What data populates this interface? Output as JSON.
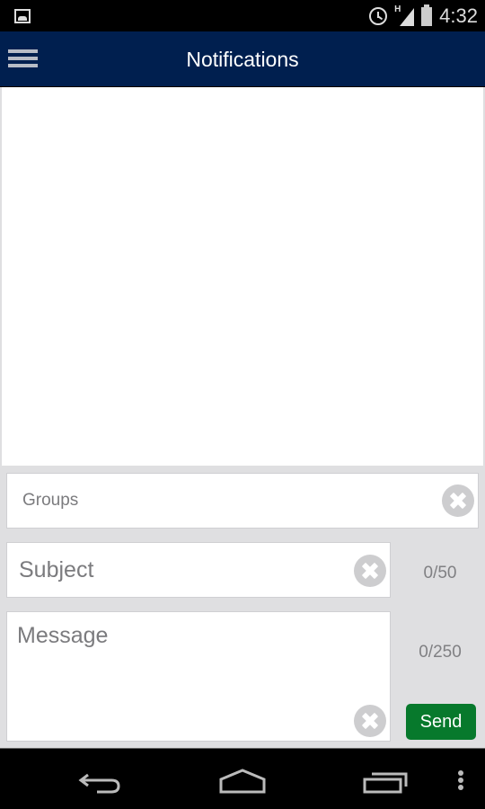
{
  "status_bar": {
    "time": "4:32",
    "network_type": "H",
    "icons": [
      "image-notification-icon",
      "alarm-icon",
      "signal-icon",
      "battery-icon"
    ]
  },
  "app_bar": {
    "title": "Notifications",
    "menu_icon": "hamburger-menu-icon"
  },
  "notifications": {
    "items": []
  },
  "form": {
    "groups": {
      "placeholder": "Groups",
      "value": ""
    },
    "subject": {
      "placeholder": "Subject",
      "value": "",
      "counter": "0/50"
    },
    "message": {
      "placeholder": "Message",
      "value": "",
      "counter": "0/250"
    },
    "send_label": "Send"
  },
  "colors": {
    "app_bar": "#001f4f",
    "send_button": "#07792c",
    "background": "#dfdfe1"
  },
  "nav_bar": {
    "buttons": [
      "back-icon",
      "home-icon",
      "recent-apps-icon",
      "overflow-menu-icon"
    ]
  }
}
